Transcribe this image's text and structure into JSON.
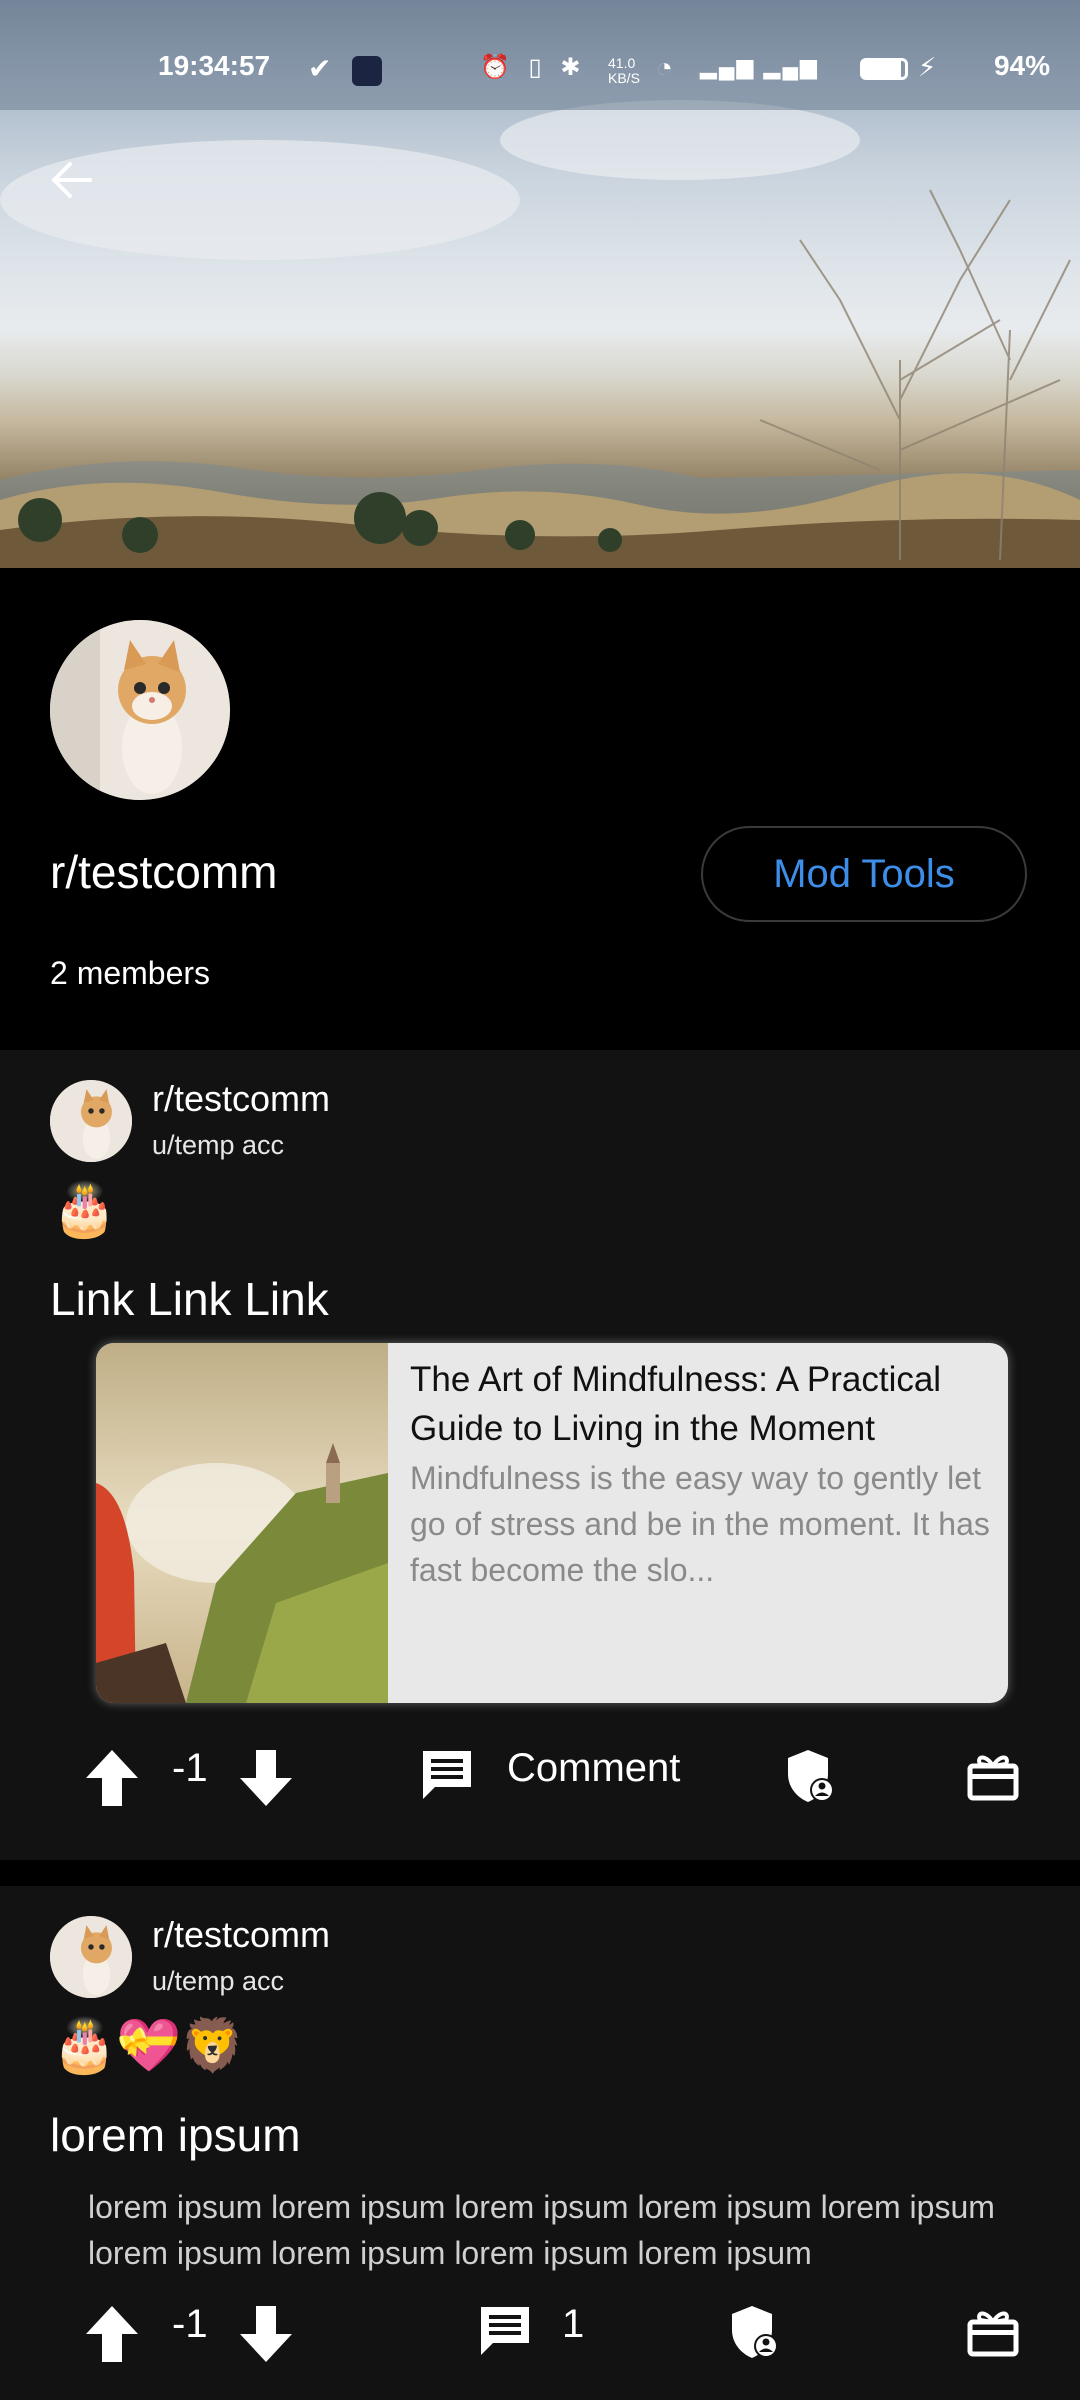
{
  "status_bar": {
    "time": "19:34:57",
    "network_speed": "41.0 KB/S",
    "battery": "94%",
    "icons": [
      "check-icon",
      "app-icon",
      "alarm-icon",
      "vibrate-icon",
      "bluetooth-icon",
      "wifi-icon",
      "volte-icon",
      "signal-icon",
      "signal-icon",
      "battery-icon",
      "charging-icon"
    ]
  },
  "community": {
    "name": "r/testcomm",
    "members": "2  members",
    "mod_tools_label": "Mod Tools"
  },
  "posts": [
    {
      "community": "r/testcomm",
      "user": "u/temp acc",
      "emojis": [
        "🎂"
      ],
      "title": "Link Link Link",
      "link": {
        "title": "The Art of Mindfulness: A Practical Guide to Living in the Moment",
        "description": "Mindfulness is the easy way to gently let go of stress and be in the moment.  It has fast become the slo..."
      },
      "votes": "-1",
      "comment_label": "Comment"
    },
    {
      "community": "r/testcomm",
      "user": "u/temp acc",
      "emojis": [
        "🎂",
        "💝",
        "🦁"
      ],
      "title": "lorem ipsum",
      "body": "lorem ipsum lorem ipsum lorem ipsum lorem ipsum lorem ipsum lorem ipsum lorem ipsum lorem ipsum lorem ipsum",
      "votes": "-1",
      "comment_count": "1"
    }
  ],
  "colors": {
    "accent": "#3d8ee8",
    "post_bg": "#121212",
    "page_bg": "#000000"
  }
}
